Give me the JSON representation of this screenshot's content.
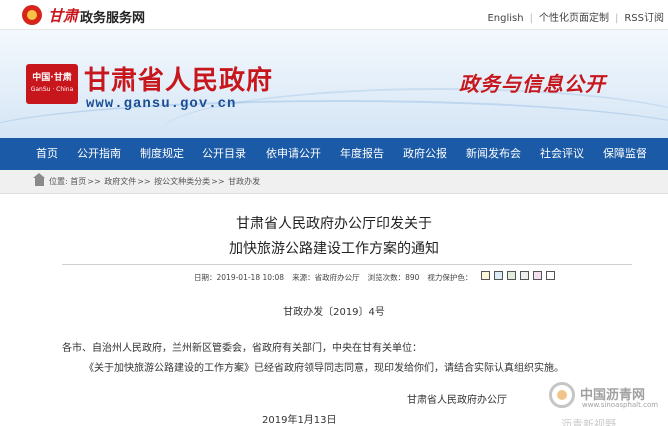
{
  "topbar": {
    "site_calligraphy": "甘肃",
    "site_name": "政务服务网",
    "links": [
      "English",
      "个性化页面定制",
      "RSS订阅"
    ]
  },
  "banner": {
    "logo_line1": "中国·甘肃",
    "logo_line2": "GanSu · China",
    "title": "甘肃省人民政府",
    "url": "www.gansu.gov.cn",
    "slogan": "政务与信息公开"
  },
  "nav": {
    "items": [
      "首页",
      "公开指南",
      "制度规定",
      "公开目录",
      "依申请公开",
      "年度报告",
      "政府公报",
      "新闻发布会",
      "社会评议",
      "保障监督"
    ]
  },
  "breadcrumb": {
    "items": [
      "位置:",
      "首页",
      "政府文件",
      "按公文种类分类",
      "甘政办发"
    ],
    "separator": ">>"
  },
  "article": {
    "title_line1": "甘肃省人民政府办公厅印发关于",
    "title_line2": "加快旅游公路建设工作方案的通知",
    "meta": {
      "date": "日期：2019-01-18 10:08",
      "source": "来源：省政府办公厅",
      "views": "浏览次数：890",
      "eye_protection_label": "视力保护色："
    },
    "swatch_colors": [
      "#fbf6d9",
      "#dcecf5",
      "#e2eedb",
      "#eeeeee",
      "#f4dff1",
      "#ffffff"
    ],
    "doc_number": "甘政办发〔2019〕4号",
    "paragraph1": "各市、自治州人民政府，兰州新区管委会，省政府有关部门，中央在甘有关单位：",
    "paragraph2": "《关于加快旅游公路建设的工作方案》已经省政府领导同志同意，现印发给你们，请结合实际认真组织实施。",
    "signature": "甘肃省人民政府办公厅",
    "sign_date": "2019年1月13日"
  },
  "watermark": {
    "name": "中国沥青网",
    "site": "www.sinoasphalt.com",
    "tag": "沥青新视野"
  },
  "colors": {
    "brand_red": "#c8161d",
    "nav_blue": "#1b5aa6"
  }
}
